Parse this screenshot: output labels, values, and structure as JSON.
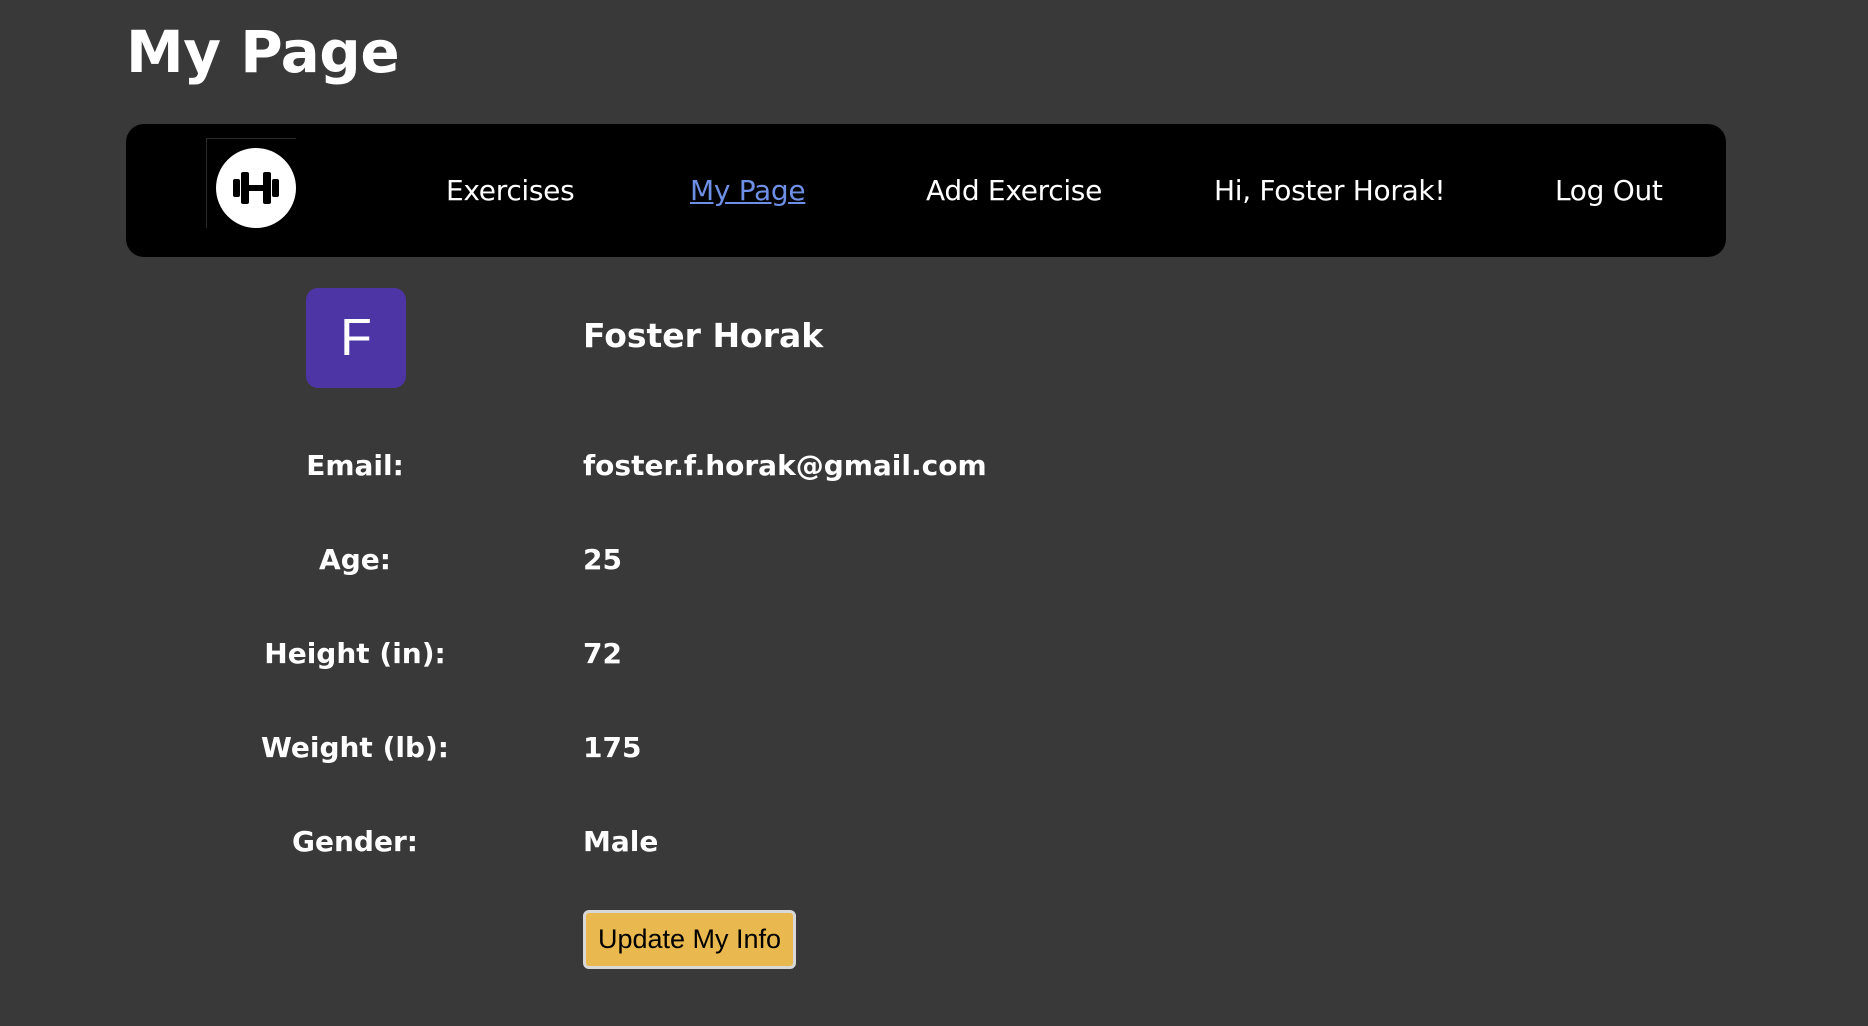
{
  "page": {
    "title": "My Page"
  },
  "nav": {
    "logo_icon": "dumbbell-icon",
    "links": [
      {
        "label": "Exercises",
        "active": false
      },
      {
        "label": "My Page",
        "active": true
      },
      {
        "label": "Add Exercise",
        "active": false
      },
      {
        "label": "Hi, Foster Horak!",
        "active": false
      },
      {
        "label": "Log Out",
        "active": false
      }
    ]
  },
  "profile": {
    "avatar_letter": "F",
    "avatar_color": "#4d35a6",
    "name": "Foster Horak",
    "fields": [
      {
        "label": "Email:",
        "value": "foster.f.horak@gmail.com"
      },
      {
        "label": "Age:",
        "value": "25"
      },
      {
        "label": "Height (in):",
        "value": "72"
      },
      {
        "label": "Weight (lb):",
        "value": "175"
      },
      {
        "label": "Gender:",
        "value": "Male"
      }
    ],
    "update_button_label": "Update My Info"
  },
  "colors": {
    "background": "#393939",
    "navbar": "#000000",
    "active_link": "#6d8fe6",
    "button": "#e9b84e"
  }
}
